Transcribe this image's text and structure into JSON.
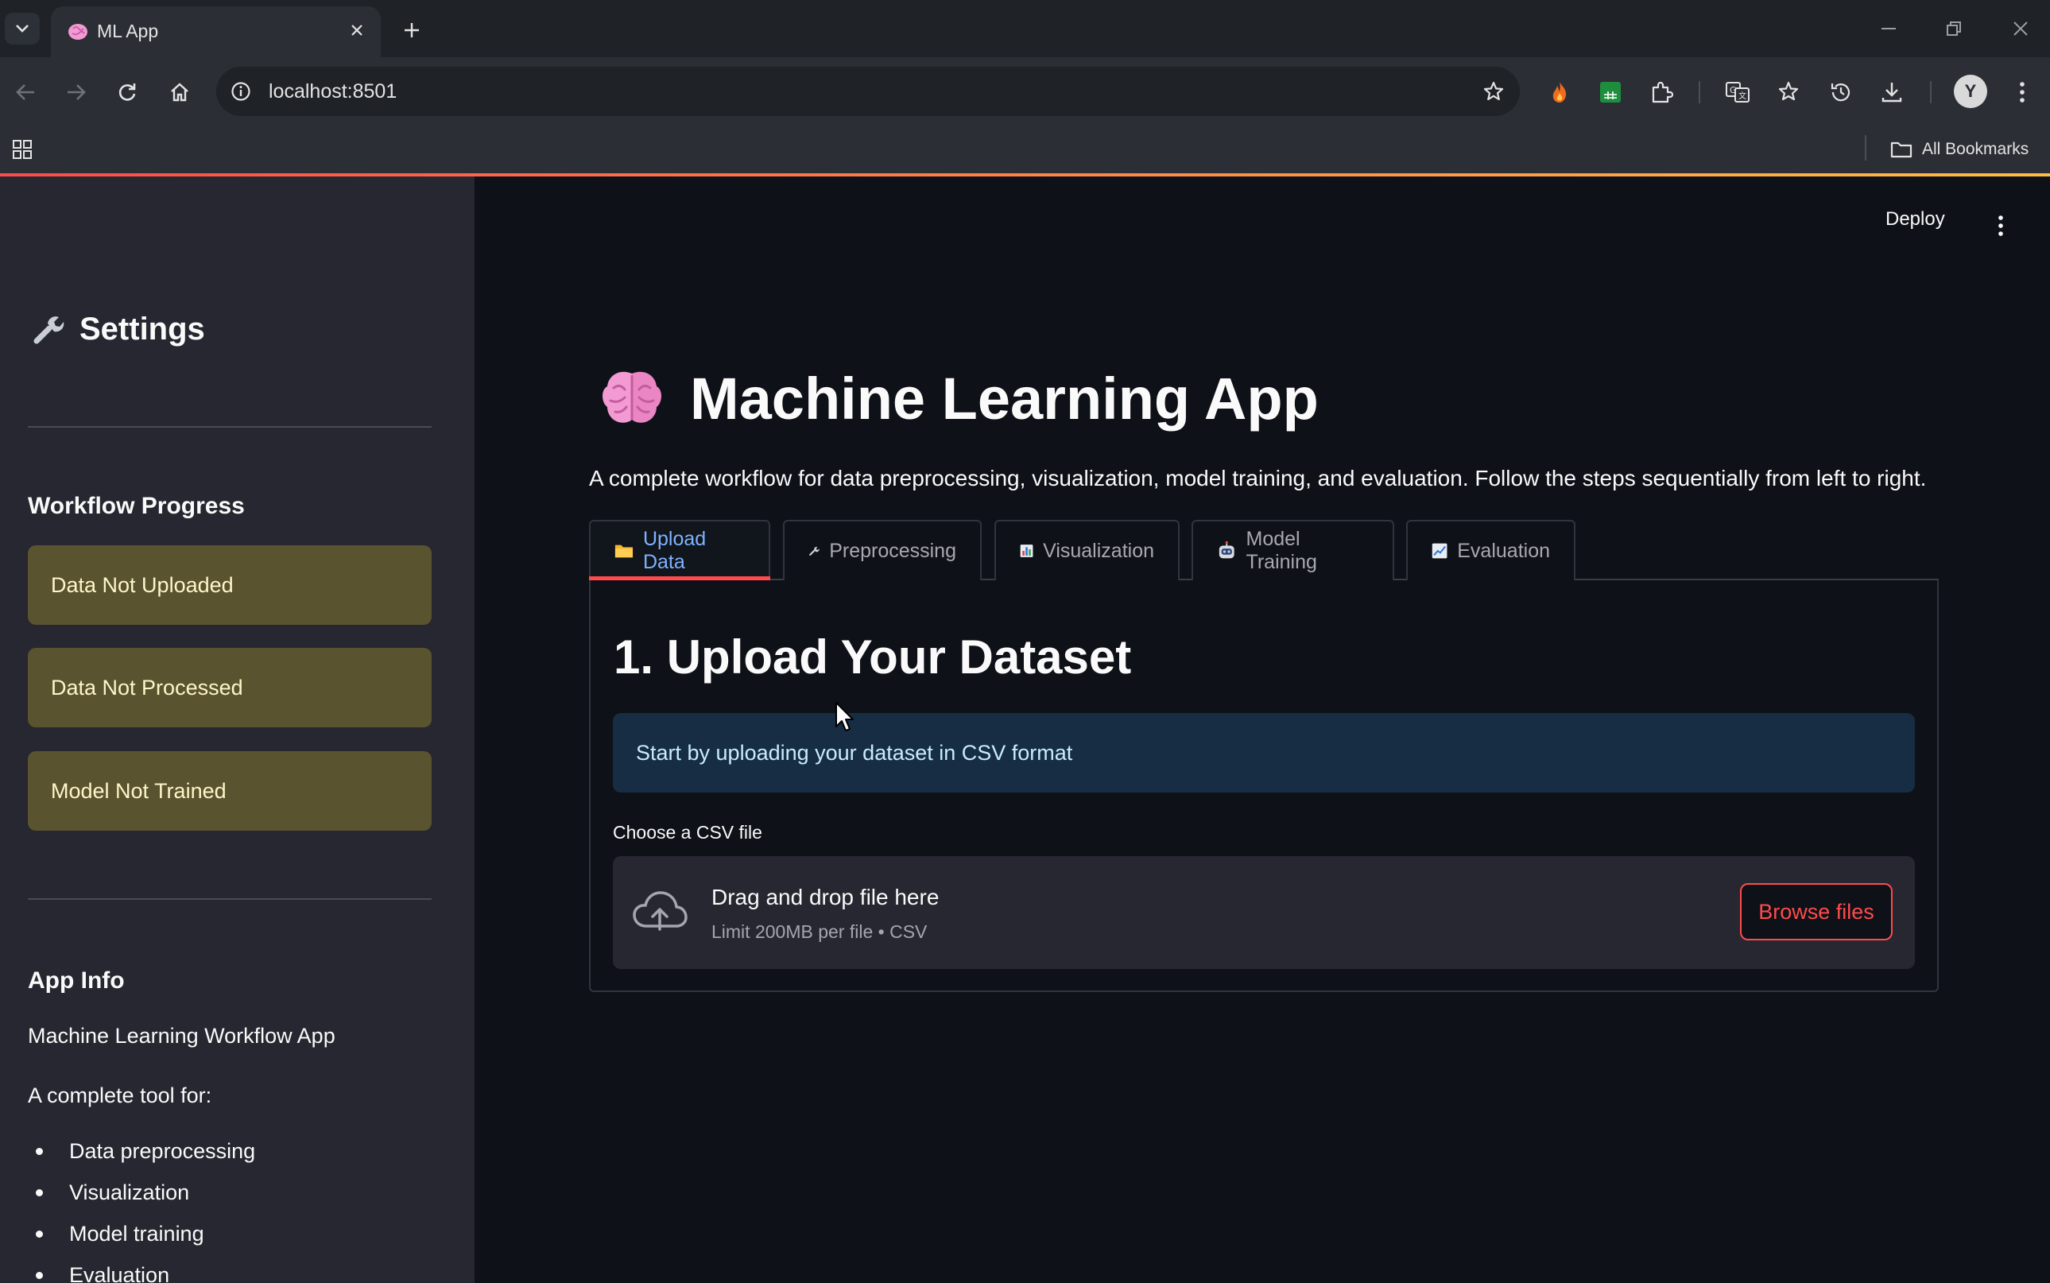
{
  "browser": {
    "tab_title": "ML App",
    "url": "localhost:8501",
    "all_bookmarks": "All Bookmarks",
    "profile_initial": "Y"
  },
  "app": {
    "deploy_label": "Deploy",
    "title": "Machine Learning App",
    "description": "A complete workflow for data preprocessing, visualization, model training, and evaluation. Follow the steps sequentially from left to right.",
    "tabs": [
      {
        "label": "Upload Data",
        "icon": "folder-icon"
      },
      {
        "label": "Preprocessing",
        "icon": "wrench-icon"
      },
      {
        "label": "Visualization",
        "icon": "bar-chart-icon"
      },
      {
        "label": "Model Training",
        "icon": "robot-icon"
      },
      {
        "label": "Evaluation",
        "icon": "line-chart-icon"
      }
    ],
    "active_tab": "Upload Data"
  },
  "sidebar": {
    "title": "Settings",
    "workflow_heading": "Workflow Progress",
    "statuses": [
      "Data Not Uploaded",
      "Data Not Processed",
      "Model Not Trained"
    ],
    "info_heading": "App Info",
    "info_name": "Machine Learning Workflow App",
    "info_intro": "A complete tool for:",
    "info_items": [
      "Data preprocessing",
      "Visualization",
      "Model training",
      "Evaluation"
    ]
  },
  "upload": {
    "heading": "1. Upload Your Dataset",
    "info": "Start by uploading your dataset in CSV format",
    "label": "Choose a CSV file",
    "drop_text": "Drag and drop file here",
    "limit_text": "Limit 200MB per file • CSV",
    "browse_label": "Browse files"
  },
  "colors": {
    "accent": "#ff4b4b",
    "active_tab_text": "#7fb2ff",
    "warning_bg": "#5a532f",
    "info_bg": "#172d43",
    "sidebar_bg": "#262730",
    "main_bg": "#0e1117"
  }
}
